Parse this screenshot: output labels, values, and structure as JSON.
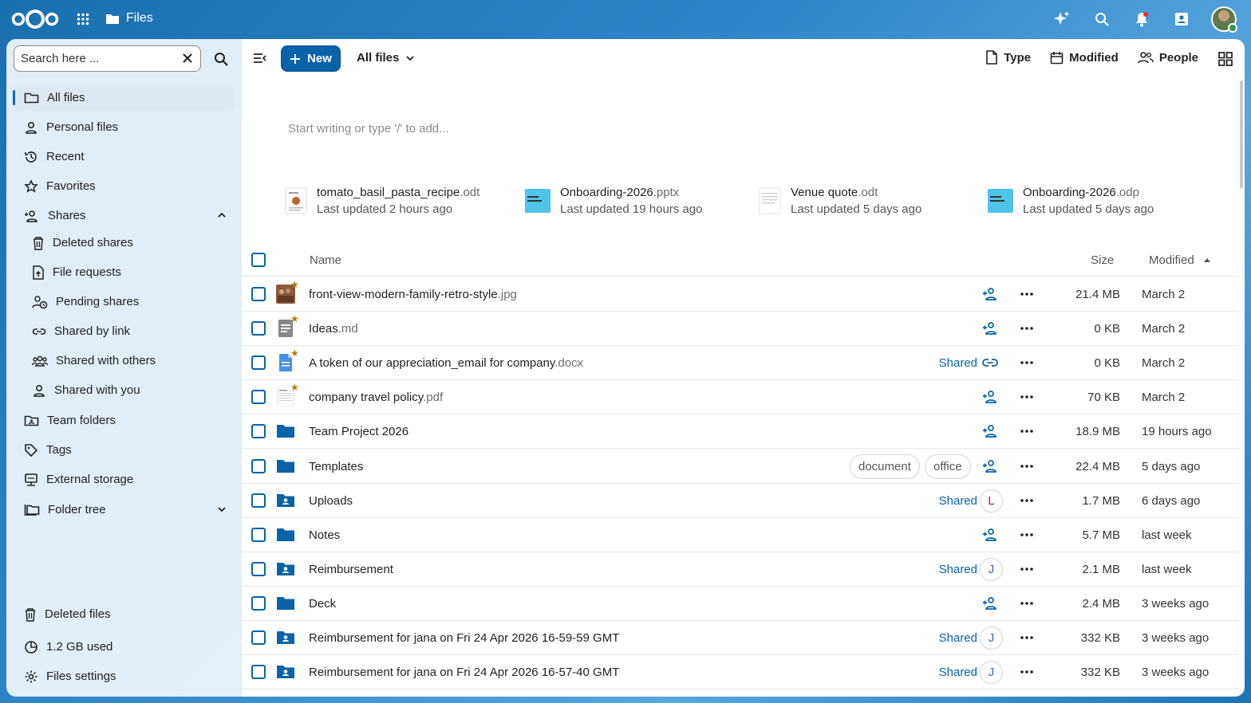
{
  "header": {
    "app_name": "Files",
    "icons": [
      "assistant-icon",
      "unified-search-icon",
      "notifications-icon",
      "contacts-icon",
      "user-avatar"
    ]
  },
  "sidebar": {
    "search_placeholder": "Search here ...",
    "items": [
      {
        "label": "All files",
        "icon": "folder-icon"
      },
      {
        "label": "Personal files",
        "icon": "person-icon"
      },
      {
        "label": "Recent",
        "icon": "history-icon"
      },
      {
        "label": "Favorites",
        "icon": "star-icon"
      },
      {
        "label": "Shares",
        "icon": "shares-icon"
      },
      {
        "label": "Deleted shares",
        "icon": "trash-icon"
      },
      {
        "label": "File requests",
        "icon": "file-upload-icon"
      },
      {
        "label": "Pending shares",
        "icon": "pending-share-icon"
      },
      {
        "label": "Shared by link",
        "icon": "link-icon"
      },
      {
        "label": "Shared with others",
        "icon": "group-icon"
      },
      {
        "label": "Shared with you",
        "icon": "person-icon"
      },
      {
        "label": "Team folders",
        "icon": "team-folder-icon"
      },
      {
        "label": "Tags",
        "icon": "tag-icon"
      },
      {
        "label": "External storage",
        "icon": "external-storage-icon"
      },
      {
        "label": "Folder tree",
        "icon": "folder-tree-icon"
      }
    ],
    "deleted_files": "Deleted files",
    "storage_used": "1.2 GB used",
    "settings": "Files settings"
  },
  "toolbar": {
    "new_label": "New",
    "breadcrumb": "All files",
    "filter_type": "Type",
    "filter_modified": "Modified",
    "filter_people": "People"
  },
  "editor": {
    "placeholder": "Start writing or type '/' to add..."
  },
  "recent_files": [
    {
      "base": "tomato_basil_pasta_recipe",
      "ext": ".odt",
      "time": "Last updated 2 hours ago"
    },
    {
      "base": "Onboarding-2026",
      "ext": ".pptx",
      "time": "Last updated 19 hours ago"
    },
    {
      "base": "Venue quote",
      "ext": ".odt",
      "time": "Last updated 5 days ago"
    },
    {
      "base": "Onboarding-2026",
      "ext": ".odp",
      "time": "Last updated 5 days ago"
    }
  ],
  "table": {
    "col_name": "Name",
    "col_size": "Size",
    "col_modified": "Modified",
    "rows": [
      {
        "base": "front-view-modern-family-retro-style",
        "ext": ".jpg",
        "size": "21.4 MB",
        "modified": "March 2"
      },
      {
        "base": "Ideas",
        "ext": ".md",
        "size": "0 KB",
        "modified": "March 2"
      },
      {
        "base": "A token of our appreciation_email for company",
        "ext": ".docx",
        "size": "0 KB",
        "modified": "March 2",
        "shared": "Shared"
      },
      {
        "base": "company travel policy",
        "ext": ".pdf",
        "size": "70 KB",
        "modified": "March 2"
      },
      {
        "base": "Team Project 2026",
        "ext": "",
        "size": "18.9 MB",
        "modified": "19 hours ago"
      },
      {
        "base": "Templates",
        "ext": "",
        "size": "22.4 MB",
        "modified": "5 days ago",
        "tags": [
          "document",
          "office"
        ]
      },
      {
        "base": "Uploads",
        "ext": "",
        "size": "1.7 MB",
        "modified": "6 days ago",
        "shared": "Shared",
        "user": "L"
      },
      {
        "base": "Notes",
        "ext": "",
        "size": "5.7 MB",
        "modified": "last week"
      },
      {
        "base": "Reimbursement",
        "ext": "",
        "size": "2.1 MB",
        "modified": "last week",
        "shared": "Shared",
        "user": "J"
      },
      {
        "base": "Deck",
        "ext": "",
        "size": "2.4 MB",
        "modified": "3 weeks ago"
      },
      {
        "base": "Reimbursement for jana on Fri 24 Apr 2026 16-59-59 GMT",
        "ext": "",
        "size": "332 KB",
        "modified": "3 weeks ago",
        "shared": "Shared",
        "user": "J"
      },
      {
        "base": "Reimbursement for jana on Fri 24 Apr 2026 16-57-40 GMT",
        "ext": "",
        "size": "332 KB",
        "modified": "3 weeks ago",
        "shared": "Shared",
        "user": "J"
      }
    ]
  },
  "colors": {
    "accent": "#0b62a7",
    "favorite": "#b9790a",
    "folder": "#0b62a7"
  }
}
